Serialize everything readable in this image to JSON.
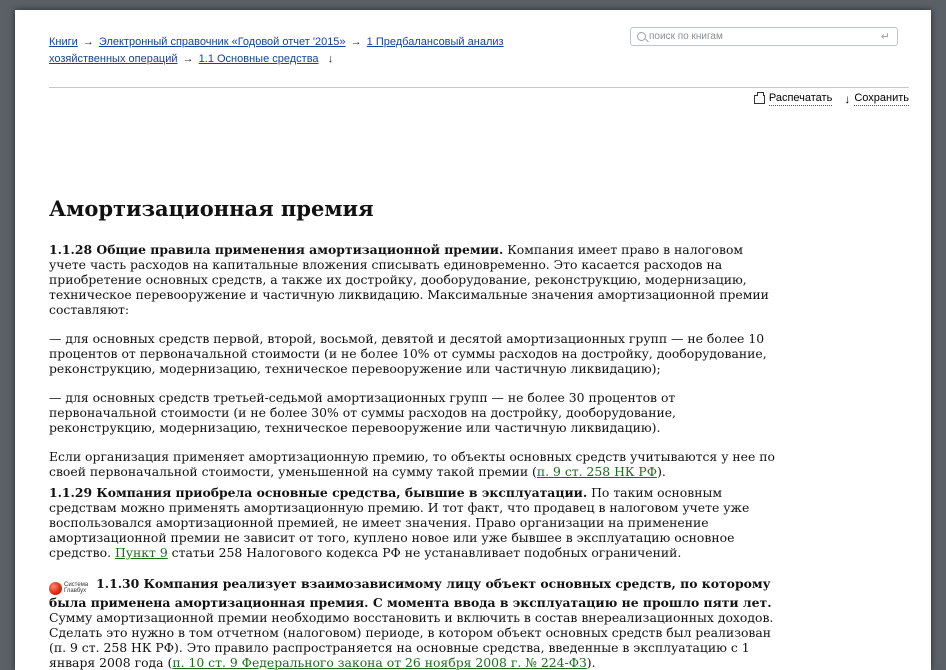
{
  "breadcrumb": {
    "items": [
      "Книги",
      "Электронный справочник «Годовой отчет '2015»",
      "1 Предбалансовый анализ хозяйственных операций",
      "1.1 Основные средства"
    ],
    "separator": "→",
    "down_arrow": "↓"
  },
  "search": {
    "placeholder": "поиск по книгам",
    "enter_glyph": "↵"
  },
  "toolbar": {
    "print_label": "Распечатать",
    "save_label": "Сохранить",
    "save_glyph": "↓"
  },
  "article": {
    "title": "Амортизационная премия",
    "s1_heading": "1.1.28 Общие правила применения амортизационной премии.",
    "s1_text": " Компания имеет право в налоговом учете часть расходов на капитальные вложения списывать единовременно. Это касается расходов на приобретение основных средств, а также их достройку, дооборудование, реконструкцию, модернизацию, техническое перевооружение и частичную ликвидацию. Максимальные значения амортизационной премии составляют:",
    "p2": "— для основных средств первой, второй, восьмой, девятой и десятой амортизационных групп — не более 10 процентов от первоначальной стоимости (и не более 10% от суммы расходов на достройку, дооборудование, реконструкцию, модернизацию, техническое перевооружение или частичную ликвидацию);",
    "p3": "— для основных средств третьей-седьмой амортизационных групп — не более 30 процентов от первоначальной стоимости (и не более 30% от суммы расходов на достройку, дооборудование, реконструкцию, модернизацию, техническое перевооружение или частичную ликвидацию).",
    "p4_text": "Если организация применяет амортизационную премию, то объекты основных средств учитываются у нее по своей первоначальной стоимости, уменьшенной на сумму такой премии (",
    "p4_link": "п. 9 ст. 258 НК РФ",
    "p4_end": ").",
    "s2_heading": "1.1.29 Компания приобрела основные средства, бывшие в эксплуатации.",
    "s2_text": " По таким основным средствам можно применять амортизационную премию. И тот факт, что продавец в налоговом учете уже воспользовался амортизационной премией, не имеет значения. Право организации на применение амортизационной премии не зависит от того, куплено новое или уже бывшее в эксплуатацию основное средство. ",
    "s2_link": "Пункт 9",
    "s2_end": " статьи 258 Налогового кодекса РФ не устанавливает подобных ограничений.",
    "badge_line1": "Система",
    "badge_line2": "Главбух",
    "s3_heading": "1.1.30 Компания реализует взаимозависимому лицу объект основных средств, по которому была применена амортизационная премия. С момента ввода в эксплуатацию не прошло пяти лет.",
    "s3_text": " Сумму амортизационной премии необходимо восстановить и включить в состав внереализационных доходов. Сделать это нужно в том отчетном (налоговом) периоде, в котором объект основных средств был реализован (п. 9 ст. 258 НК РФ). Это правило распространяется на основные средства, введенные в эксплуатацию с 1 января 2008 года (",
    "s3_link": "п. 10 ст. 9 Федерального закона от 26 ноября 2008 г. № 224-ФЗ",
    "s3_end": ")."
  },
  "colors": {
    "link_blue": "#1a3fa3",
    "link_green": "#1c6b1c",
    "backdrop": "#5a6066"
  }
}
